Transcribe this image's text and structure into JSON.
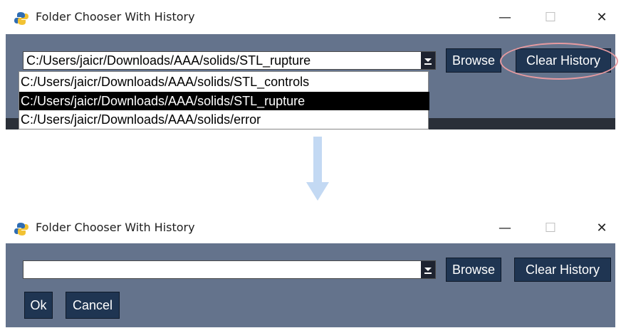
{
  "top_window": {
    "title": "Folder Chooser With History",
    "controls": {
      "minimize": "—",
      "maximize": "☐",
      "close": "✕"
    },
    "combo_value": "C:/Users/jaicr/Downloads/AAA/solids/STL_rupture",
    "browse_label": "Browse",
    "clear_history_label": "Clear History",
    "dropdown_items": [
      "C:/Users/jaicr/Downloads/AAA/solids/STL_controls",
      "C:/Users/jaicr/Downloads/AAA/solids/STL_rupture",
      "C:/Users/jaicr/Downloads/AAA/solids/error"
    ],
    "selected_item": "C:/Users/jaicr/Downloads/AAA/solids/STL_rupture"
  },
  "bottom_window": {
    "title": "Folder Chooser With History",
    "controls": {
      "minimize": "—",
      "maximize": "☐",
      "close": "✕"
    },
    "combo_value": "",
    "browse_label": "Browse",
    "clear_history_label": "Clear History",
    "ok_label": "Ok",
    "cancel_label": "Cancel"
  },
  "colors": {
    "panel_bg": "#64738c",
    "button_bg": "#1f3552",
    "highlight": "#e69aa0",
    "arrow": "#c3d9f3"
  },
  "icons": {
    "app": "python-logo-icon",
    "transition": "down-arrow-icon"
  }
}
